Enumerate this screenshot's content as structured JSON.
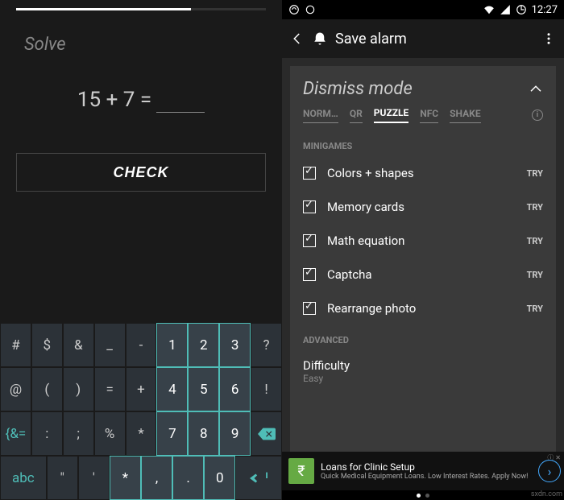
{
  "left": {
    "solve_label": "Solve",
    "equation": "15 + 7 =",
    "answer": "",
    "check_label": "CHECK",
    "keyboard": {
      "row1": [
        "#",
        "$",
        "&",
        "_",
        "-",
        "1",
        "2",
        "3",
        "?"
      ],
      "row2": [
        "@",
        "(",
        ")",
        "=",
        "+",
        "4",
        "5",
        "6",
        "!"
      ],
      "row3": [
        "{&=",
        ":",
        ";",
        "%",
        "*",
        "7",
        "8",
        "9",
        "⌫"
      ],
      "row4": [
        "abc",
        "\"",
        "'",
        "*",
        ",",
        ".",
        "0",
        "↵"
      ]
    }
  },
  "right": {
    "status": {
      "time": "12:27"
    },
    "navbar": {
      "title": "Save alarm"
    },
    "card_title": "Dismiss mode",
    "tabs": [
      "NORM…",
      "QR",
      "PUZZLE",
      "NFC",
      "SHAKE"
    ],
    "active_tab": "PUZZLE",
    "minigames_label": "MINIGAMES",
    "minigames": [
      {
        "label": "Colors + shapes",
        "checked": true
      },
      {
        "label": "Memory cards",
        "checked": true
      },
      {
        "label": "Math equation",
        "checked": true
      },
      {
        "label": "Captcha",
        "checked": true
      },
      {
        "label": "Rearrange photo",
        "checked": true
      }
    ],
    "try_label": "TRY",
    "advanced_label": "ADVANCED",
    "difficulty": {
      "label": "Difficulty",
      "value": "Easy"
    },
    "ad": {
      "title": "Loans for Clinic Setup",
      "subtitle": "Quick Medical Equipment Loans. Low Interest Rates. Apply Now!",
      "badge": "ⓘ ✕"
    }
  },
  "watermark": "sxdn.com"
}
